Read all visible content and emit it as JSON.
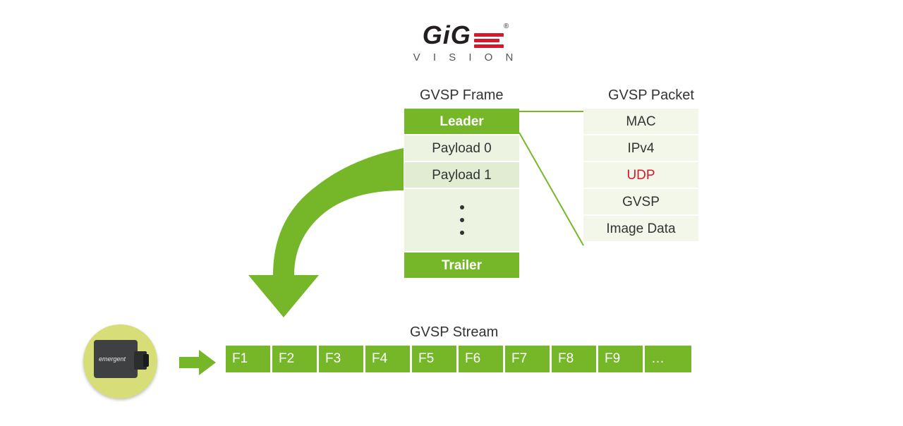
{
  "logo": {
    "top": "GiG",
    "sub": "V I S I O N",
    "reg": "®"
  },
  "titles": {
    "frame": "GVSP Frame",
    "packet": "GVSP Packet",
    "stream": "GVSP Stream"
  },
  "frame": {
    "leader": "Leader",
    "payload0": "Payload 0",
    "payload1": "Payload 1",
    "trailer": "Trailer"
  },
  "packet": {
    "mac": "MAC",
    "ipv4": "IPv4",
    "udp": "UDP",
    "gvsp": "GVSP",
    "image": "Image Data"
  },
  "stream": {
    "f1": "F1",
    "f2": "F2",
    "f3": "F3",
    "f4": "F4",
    "f5": "F5",
    "f6": "F6",
    "f7": "F7",
    "f8": "F8",
    "f9": "F9",
    "more": "…"
  },
  "camera": {
    "brand": "emergent"
  }
}
